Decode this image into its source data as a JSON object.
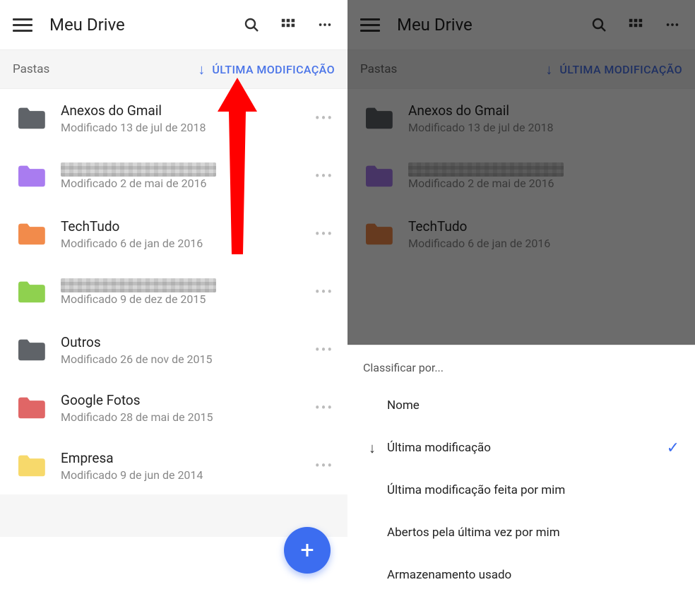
{
  "header": {
    "title": "Meu Drive"
  },
  "sort": {
    "section_label": "Pastas",
    "direction_icon": "↓",
    "value": "ÚLTIMA MODIFICAÇÃO"
  },
  "folders": [
    {
      "name": "Anexos do Gmail",
      "sub": "Modificado 13 de jul de 2018",
      "color": "#5f6368",
      "redacted": false
    },
    {
      "name": "",
      "sub": "Modificado 2 de mai de 2016",
      "color": "#a97cf0",
      "redacted": true
    },
    {
      "name": "TechTudo",
      "sub": "Modificado 6 de jan de 2016",
      "color": "#f28b4b",
      "redacted": false
    },
    {
      "name": "",
      "sub": "Modificado 9 de dez de 2015",
      "color": "#8fd14f",
      "redacted": true
    },
    {
      "name": "Outros",
      "sub": "Modificado 26 de nov de 2015",
      "color": "#5f6368",
      "redacted": false
    },
    {
      "name": "Google Fotos",
      "sub": "Modificado 28 de mai de 2015",
      "color": "#e06666",
      "redacted": false
    },
    {
      "name": "Empresa",
      "sub": "Modificado 9 de jun de 2014",
      "color": "#f7d96b",
      "redacted": false
    }
  ],
  "folders_right": [
    {
      "name": "Anexos do Gmail",
      "sub": "Modificado 13 de jul de 2018",
      "color": "#5f6368",
      "redacted": false
    },
    {
      "name": "",
      "sub": "Modificado 2 de mai de 2016",
      "color": "#a97cf0",
      "redacted": true
    },
    {
      "name": "TechTudo",
      "sub": "Modificado 6 de jan de 2016",
      "color": "#f28b4b",
      "redacted": false
    }
  ],
  "sheet": {
    "title": "Classificar por...",
    "options": [
      {
        "label": "Nome",
        "selected": false,
        "dir": ""
      },
      {
        "label": "Última modificação",
        "selected": true,
        "dir": "↓"
      },
      {
        "label": "Última modificação feita por mim",
        "selected": false,
        "dir": ""
      },
      {
        "label": "Abertos pela última vez por mim",
        "selected": false,
        "dir": ""
      },
      {
        "label": "Armazenamento usado",
        "selected": false,
        "dir": ""
      }
    ]
  },
  "fab_icon": "+"
}
